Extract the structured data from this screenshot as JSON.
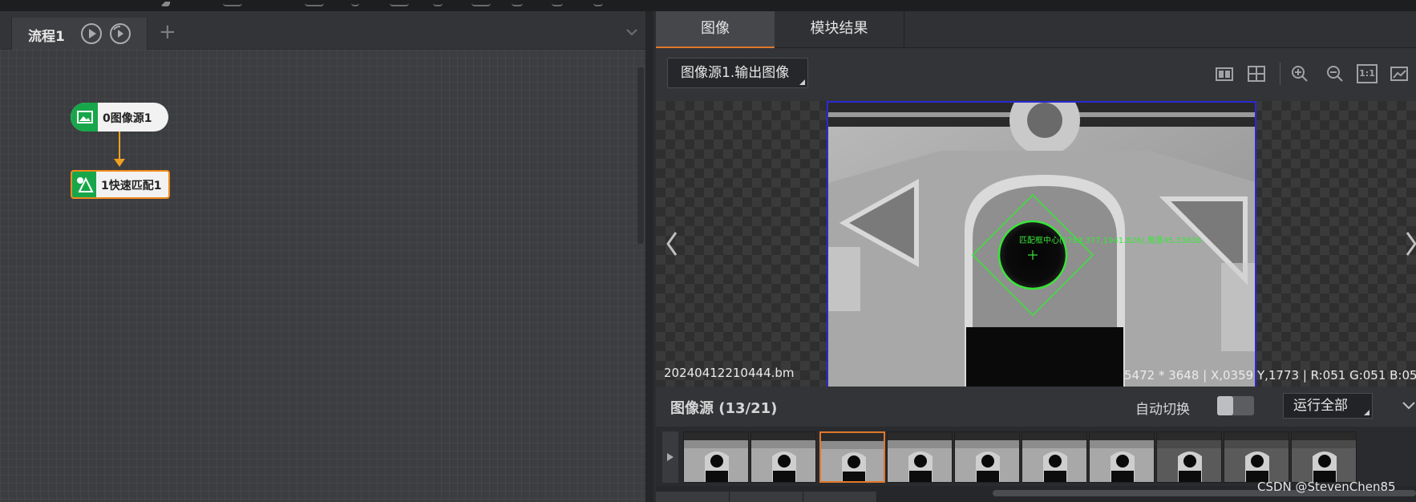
{
  "flow_panel": {
    "tab_label": "流程1",
    "nodes": [
      {
        "label": "0图像源1",
        "icon": "image-icon"
      },
      {
        "label": "1快速匹配1",
        "icon": "match-icon"
      }
    ],
    "add_tab_symbol": "+"
  },
  "right_panel": {
    "tabs": [
      "图像",
      "模块结果"
    ],
    "active_tab": "图像",
    "image_selector": "图像源1.输出图像",
    "toolbar_icons": [
      "layout-split-icon",
      "crosshair-grid-icon",
      "zoom-in-icon",
      "zoom-out-icon",
      "actual-size-icon",
      "fit-icon"
    ],
    "actual_size_label": "1:1",
    "viewer": {
      "filename": "20240412210444.bm",
      "pixel_info": "5472 * 3648  |  X,0359  Y,1773  |  R:051   G:051   B:05",
      "match_annotation": "匹配框中心(2783.377,1941.826),角度45.33836"
    },
    "image_source": {
      "title": "图像源 (13/21)",
      "auto_switch_label": "自动切换",
      "auto_switch_on": false,
      "run_all_label": "运行全部",
      "thumbnail_count": 10,
      "selected_thumbnail": 3
    }
  },
  "watermark": "CSDN @StevenChen85",
  "colors": {
    "accent_orange": "#e0782a",
    "node_green": "#17a74a",
    "match_green": "#39e639",
    "roi_border": "#2a2ad6"
  }
}
